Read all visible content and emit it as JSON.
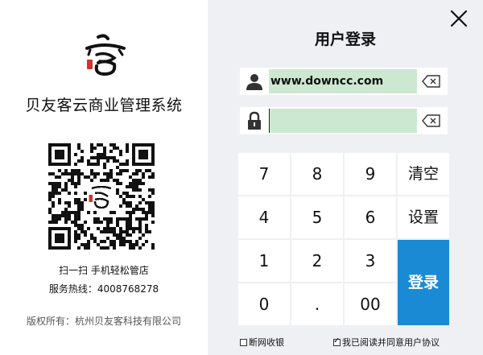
{
  "brand": {
    "app_name": "贝友客云商业管理系统",
    "scan_text": "扫一扫 手机轻松管店",
    "hotline": "服务热线：4008768278",
    "copyright": "版权所有：杭州贝友客科技有限公司"
  },
  "login": {
    "title": "用户登录",
    "username_value": "www.downcc.com",
    "password_value": ""
  },
  "keypad": {
    "keys": [
      "7",
      "8",
      "9",
      "清空",
      "4",
      "5",
      "6",
      "设置",
      "1",
      "2",
      "3",
      "0",
      ".",
      "00"
    ],
    "login_label": "登录"
  },
  "options": {
    "offline_label": "断网收银",
    "offline_checked": false,
    "agree_label": "我已阅读并同意用户协议",
    "agree_checked": true
  },
  "colors": {
    "accent": "#1a8ad4",
    "field_fill": "#cde8d0",
    "panel_bg": "#eef0f4",
    "logo_red": "#d0342c"
  },
  "icons": {
    "close": "close-icon",
    "user": "user-icon",
    "lock": "lock-icon",
    "clear": "backspace-clear-icon",
    "logo": "brand-logo-icon",
    "qr": "qr-code"
  }
}
